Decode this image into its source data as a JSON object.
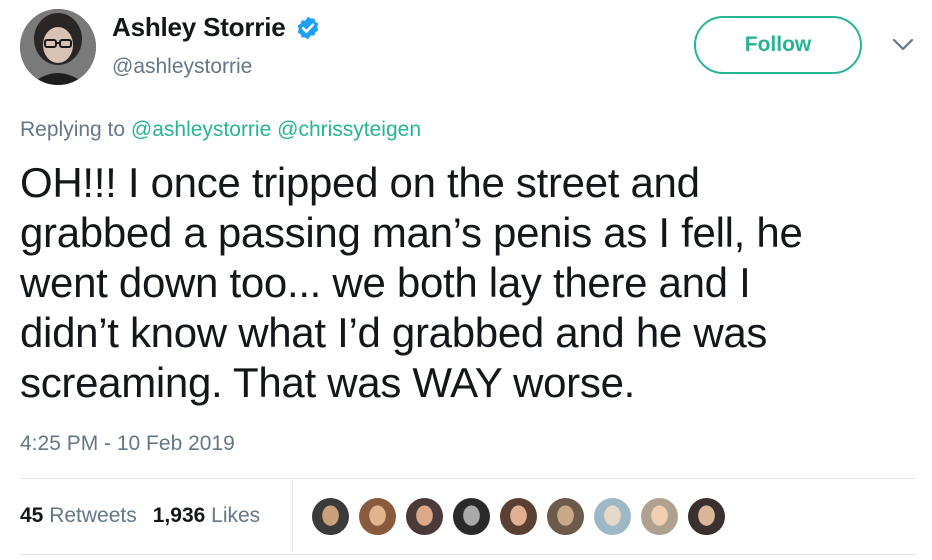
{
  "author": {
    "display_name": "Ashley Storrie",
    "handle": "@ashleystorrie",
    "verified": true,
    "avatar_icon": "profile-photo-avatar"
  },
  "actions": {
    "follow_label": "Follow",
    "more_icon": "chevron-down-icon"
  },
  "reply": {
    "prefix": "Replying to",
    "mentions": [
      "@ashleystorrie",
      "@chrissyteigen"
    ]
  },
  "tweet": {
    "lines": [
      "OH!!! I once tripped on the street and",
      "grabbed a passing man’s penis as I fell, he",
      "went down too... we both lay there and I",
      "didn’t know what I’d grabbed and he was",
      "screaming. That was WAY worse."
    ],
    "timestamp": "4:25 PM - 10 Feb 2019"
  },
  "stats": {
    "retweets_count": "45",
    "retweets_label": "Retweets",
    "likes_count": "1,936",
    "likes_label": "Likes"
  },
  "colors": {
    "accent": "#26b495",
    "muted": "#657786",
    "text": "#14171a",
    "verified": "#1da1f2"
  },
  "liker_avatars": [
    {
      "name": "liker-avatar-1",
      "bg": "#3b3b3b",
      "fg": "#c9a07a"
    },
    {
      "name": "liker-avatar-2",
      "bg": "#8a5a3c",
      "fg": "#e3b48e"
    },
    {
      "name": "liker-avatar-3",
      "bg": "#4a3a3a",
      "fg": "#d9a98a"
    },
    {
      "name": "liker-avatar-4",
      "bg": "#2a2a2a",
      "fg": "#a9a9a9"
    },
    {
      "name": "liker-avatar-5",
      "bg": "#5a4032",
      "fg": "#e0b090"
    },
    {
      "name": "liker-avatar-6",
      "bg": "#6d5a4a",
      "fg": "#c8a888"
    },
    {
      "name": "liker-avatar-7",
      "bg": "#9fb8c8",
      "fg": "#e8d8c8"
    },
    {
      "name": "liker-avatar-8",
      "bg": "#b0a090",
      "fg": "#f0d0b0"
    },
    {
      "name": "liker-avatar-9",
      "bg": "#3a3030",
      "fg": "#d8b898"
    }
  ]
}
